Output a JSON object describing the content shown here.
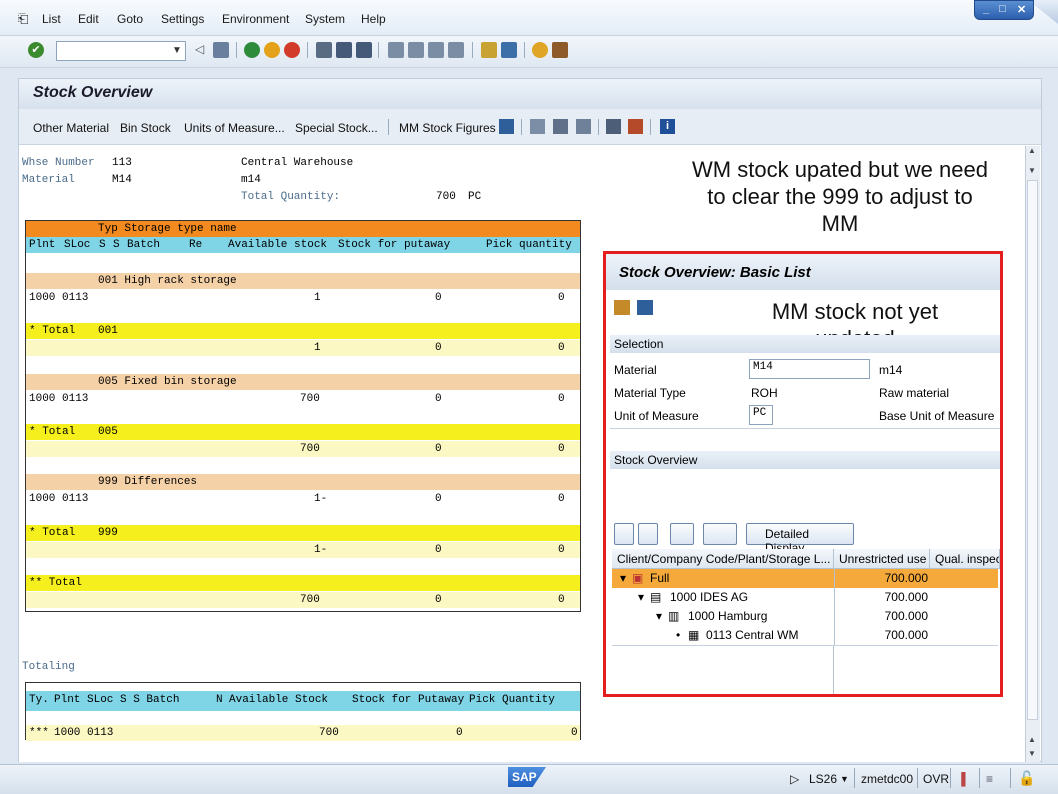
{
  "menu": {
    "items": [
      "List",
      "Edit",
      "Goto",
      "Settings",
      "Environment",
      "System",
      "Help"
    ]
  },
  "page": {
    "title": "Stock Overview"
  },
  "app_toolbar": {
    "buttons": [
      "Other Material",
      "Bin Stock",
      "Units of Measure...",
      "Special Stock...",
      "MM Stock Figures"
    ]
  },
  "header": {
    "whse_label": "Whse Number",
    "whse_value": "113",
    "whse_desc": "Central Warehouse",
    "material_label": "Material",
    "material_value": "M14",
    "material_desc": "m14",
    "total_label": "Total Quantity:",
    "total_value": "700",
    "total_unit": "PC"
  },
  "stock_table": {
    "header1": "Typ Storage type name",
    "header2": [
      "Plnt",
      "SLoc",
      "S",
      "S",
      "Batch",
      "Re",
      "Available stock",
      "Stock for putaway",
      "Pick quantity"
    ],
    "groups": [
      {
        "type_line": "001 High rack storage",
        "plnt_sloc": "1000 0113",
        "avail": "1",
        "putaway": "0",
        "pick": "0",
        "total_label": "* Total",
        "total_type": "001",
        "t_avail": "1",
        "t_putaway": "0",
        "t_pick": "0"
      },
      {
        "type_line": "005 Fixed bin storage",
        "plnt_sloc": "1000 0113",
        "avail": "700",
        "putaway": "0",
        "pick": "0",
        "total_label": "* Total",
        "total_type": "005",
        "t_avail": "700",
        "t_putaway": "0",
        "t_pick": "0"
      },
      {
        "type_line": "999 Differences",
        "plnt_sloc": "1000 0113",
        "avail": "1-",
        "putaway": "0",
        "pick": "0",
        "total_label": "* Total",
        "total_type": "999",
        "t_avail": "1-",
        "t_putaway": "0",
        "t_pick": "0"
      }
    ],
    "grand_total_label": "** Total",
    "grand_avail": "700",
    "grand_putaway": "0",
    "grand_pick": "0"
  },
  "totaling": {
    "title": "Totaling",
    "headers": [
      "Ty.",
      "Plnt SLoc S S Batch",
      "N",
      "Available Stock",
      "Stock for Putaway",
      "Pick Quantity"
    ],
    "row": {
      "ty": "***",
      "plnt": "1000 0113",
      "avail": "700",
      "putaway": "0",
      "pick": "0"
    }
  },
  "annotations": {
    "wm_note": "WM stock upated but we need to clear the 999 to adjust to MM",
    "mm_note": "MM stock not yet updated"
  },
  "popup": {
    "title": "Stock Overview: Basic List",
    "selection_label": "Selection",
    "fields": [
      {
        "label": "Material",
        "value": "M14",
        "desc": "m14"
      },
      {
        "label": "Material Type",
        "value": "ROH",
        "desc": "Raw material"
      },
      {
        "label": "Unit of Measure",
        "value": "PC",
        "desc": "Base Unit of Measure"
      }
    ],
    "overview_label": "Stock Overview",
    "detailed_display": "Detailed Display",
    "grid_headers": [
      "Client/Company Code/Plant/Storage L...",
      "Unrestricted use",
      "Qual. inspect"
    ],
    "grid_rows": [
      {
        "label": "Full",
        "value": "700.000"
      },
      {
        "label": "1000 IDES AG",
        "value": "700.000"
      },
      {
        "label": "1000 Hamburg",
        "value": "700.000"
      },
      {
        "label": "0113 Central WM",
        "value": "700.000"
      }
    ]
  },
  "status": {
    "sap": "SAP",
    "system": "LS26",
    "client": "zmetdc00",
    "mode": "OVR"
  },
  "colors": {
    "orange": "#f28a1f",
    "peach": "#f5d1a8",
    "yellow": "#f5ef1e",
    "light_yellow": "#fbf8c4",
    "cyan": "#7fd4e6",
    "red_frame": "#e41e1e"
  }
}
